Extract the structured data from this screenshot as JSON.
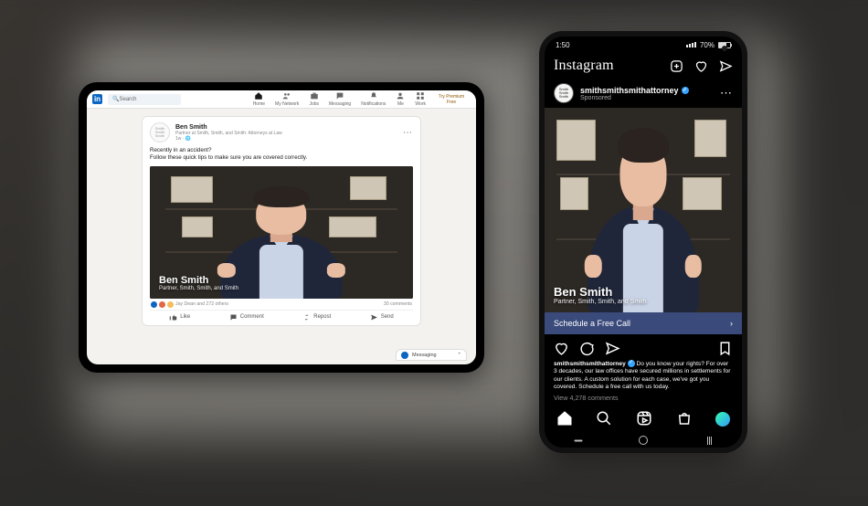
{
  "speaker": {
    "name": "Ben Smith",
    "title_line": "Partner, Smith, Smith, and Smith"
  },
  "linkedin": {
    "search_placeholder": "Search",
    "nav": {
      "home": "Home",
      "network": "My Network",
      "jobs": "Jobs",
      "messaging": "Messaging",
      "notifications": "Notifications",
      "me": "Me",
      "work": "Work",
      "premium": "Try Premium Free"
    },
    "post": {
      "author_name": "Ben Smith",
      "author_sub": "Partner at Smith, Smith, and Smith: Attorneys at Law",
      "time_line": "1w · 🌐",
      "body_line1": "Recently in an accident?",
      "body_line2": "Follow these quick tips to make sure you are covered correctly.",
      "reactions_text": "Jay Dean and 272 others",
      "comments_text": "30 comments",
      "actions": {
        "like": "Like",
        "comment": "Comment",
        "repost": "Repost",
        "send": "Send"
      }
    },
    "messaging_label": "Messaging"
  },
  "instagram": {
    "status": {
      "time": "1:50",
      "battery_pct": "70%"
    },
    "logo": "Instagram",
    "author": {
      "username": "smithsmithsmithattorney",
      "sub": "Sponsored"
    },
    "cta": "Schedule a Free Call",
    "caption_user": "smithsmithsmithattorney",
    "caption_text": "Do you know your rights? For over 3 decades, our law offices have secured millions in settlements for our clients. A custom solution for each case, we've got you covered. Schedule a free call with us today.",
    "view_comments": "View 4,278 comments"
  }
}
